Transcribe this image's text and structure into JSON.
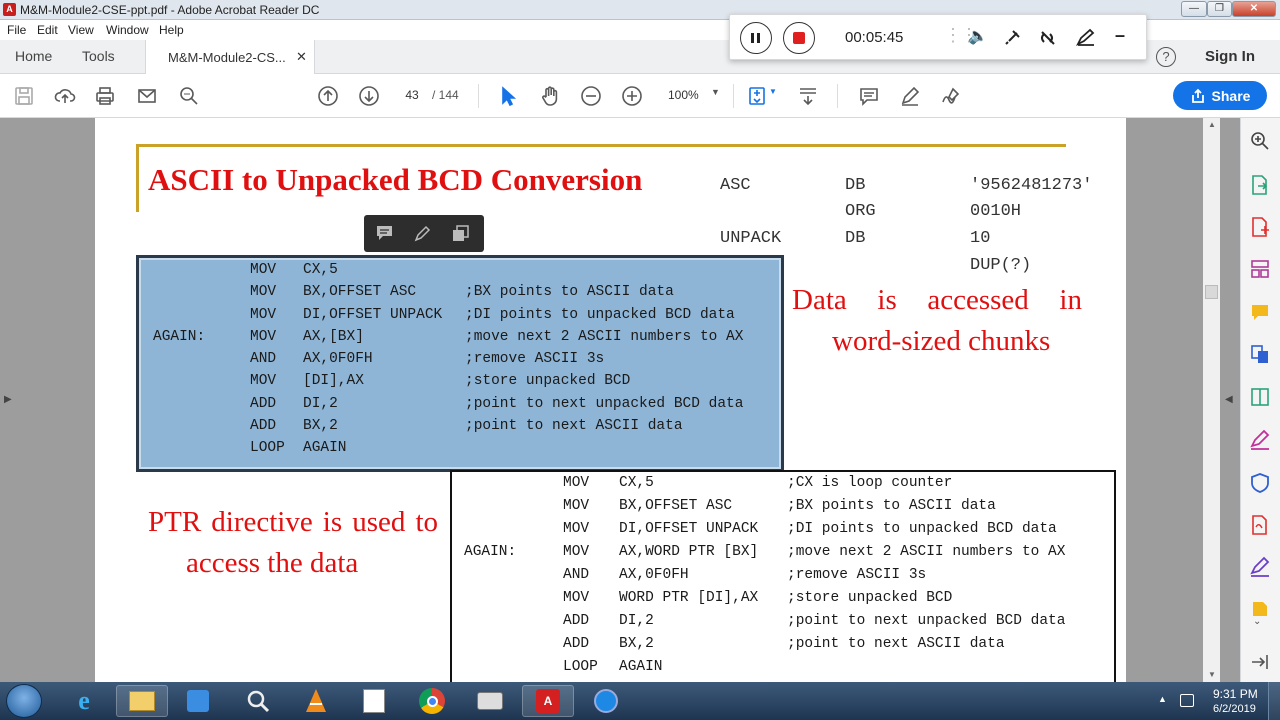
{
  "window": {
    "title": "M&M-Module2-CSE-ppt.pdf - Adobe Acrobat Reader DC"
  },
  "menu": [
    "File",
    "Edit",
    "View",
    "Window",
    "Help"
  ],
  "tabs": {
    "home": "Home",
    "tools": "Tools",
    "doc": "M&M-Module2-CS..."
  },
  "header": {
    "sign_in": "Sign In",
    "share": "Share"
  },
  "toolbar": {
    "page_current": "43",
    "page_total": "/ 144",
    "zoom": "100%"
  },
  "recorder": {
    "time": "00:05:45"
  },
  "slide": {
    "title": "ASCII to Unpacked BCD Conversion",
    "data_decl": [
      {
        "label": "ASC",
        "dir": "DB",
        "val": "'9562481273'"
      },
      {
        "label": "",
        "dir": "ORG",
        "val": "0010H"
      },
      {
        "label": "UNPACK",
        "dir": "DB",
        "val": "10 DUP(?)"
      }
    ],
    "code1": [
      {
        "label": "",
        "op": "MOV",
        "arg": "CX,5",
        "cmt": ""
      },
      {
        "label": "",
        "op": "MOV",
        "arg": "BX,OFFSET ASC",
        "cmt": ";BX points to ASCII data"
      },
      {
        "label": "",
        "op": "MOV",
        "arg": "DI,OFFSET UNPACK",
        "cmt": ";DI points to unpacked BCD data"
      },
      {
        "label": "AGAIN:",
        "op": "MOV",
        "arg": "AX,[BX]",
        "cmt": ";move next 2 ASCII numbers to AX"
      },
      {
        "label": "",
        "op": "AND",
        "arg": "AX,0F0FH",
        "cmt": ";remove ASCII 3s"
      },
      {
        "label": "",
        "op": "MOV",
        "arg": "[DI],AX",
        "cmt": ";store unpacked BCD"
      },
      {
        "label": "",
        "op": "ADD",
        "arg": "DI,2",
        "cmt": ";point to next unpacked BCD data"
      },
      {
        "label": "",
        "op": "ADD",
        "arg": "BX,2",
        "cmt": ";point to next ASCII data"
      },
      {
        "label": "",
        "op": "LOOP",
        "arg": "AGAIN",
        "cmt": ""
      }
    ],
    "note1": "Data is accessed in word-sized chunks",
    "note2": "PTR directive is used to access the data",
    "code2": [
      {
        "label": "",
        "op": "MOV",
        "arg": "CX,5",
        "cmt": ";CX is loop counter"
      },
      {
        "label": "",
        "op": "MOV",
        "arg": "BX,OFFSET ASC",
        "cmt": ";BX points to ASCII data"
      },
      {
        "label": "",
        "op": "MOV",
        "arg": "DI,OFFSET UNPACK",
        "cmt": ";DI points to unpacked BCD data"
      },
      {
        "label": "AGAIN:",
        "op": "MOV",
        "arg": "AX,WORD PTR [BX]",
        "cmt": ";move next 2 ASCII numbers to AX"
      },
      {
        "label": "",
        "op": "AND",
        "arg": "AX,0F0FH",
        "cmt": ";remove ASCII 3s"
      },
      {
        "label": "",
        "op": "MOV",
        "arg": "WORD PTR [DI],AX",
        "cmt": ";store unpacked BCD"
      },
      {
        "label": "",
        "op": "ADD",
        "arg": "DI,2",
        "cmt": ";point to next unpacked BCD data"
      },
      {
        "label": "",
        "op": "ADD",
        "arg": "BX,2",
        "cmt": ";point to next ASCII data"
      },
      {
        "label": "",
        "op": "LOOP",
        "arg": "AGAIN",
        "cmt": ""
      }
    ]
  },
  "clock": {
    "time": "9:31 PM",
    "date": "6/2/2019"
  },
  "colors": {
    "accent": "#1473e6",
    "title_red": "#e01010",
    "code_bg": "#8fb5d6",
    "gold": "#c9a227"
  }
}
